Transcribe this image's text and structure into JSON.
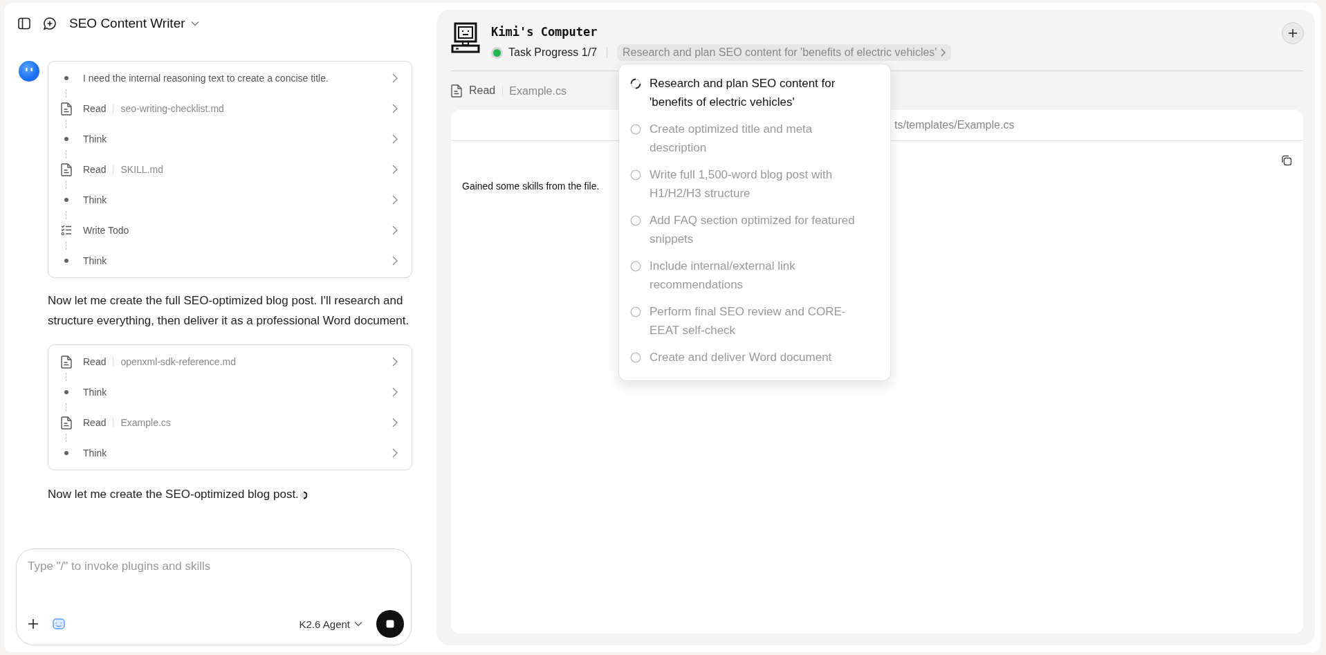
{
  "chat": {
    "title": "SEO Content Writer",
    "step_groups": [
      {
        "steps": [
          {
            "kind": "think",
            "label": "I need the internal reasoning text to create a concise title."
          },
          {
            "kind": "read",
            "label": "Read",
            "file": "seo-writing-checklist.md"
          },
          {
            "kind": "think",
            "label": "Think"
          },
          {
            "kind": "read",
            "label": "Read",
            "file": "SKILL.md"
          },
          {
            "kind": "think",
            "label": "Think"
          },
          {
            "kind": "todo",
            "label": "Write Todo"
          },
          {
            "kind": "think",
            "label": "Think"
          }
        ],
        "after": "Now let me create the full SEO-optimized blog post. I'll research and structure everything, then deliver it as a professional Word document."
      },
      {
        "steps": [
          {
            "kind": "read",
            "label": "Read",
            "file": "openxml-sdk-reference.md"
          },
          {
            "kind": "think",
            "label": "Think"
          },
          {
            "kind": "read",
            "label": "Read",
            "file": "Example.cs"
          },
          {
            "kind": "think",
            "label": "Think"
          }
        ],
        "after": "Now let me create the SEO-optimized blog post."
      }
    ],
    "composer": {
      "placeholder": "Type \"/\" to invoke plugins and skills",
      "model": "K2.6 Agent"
    }
  },
  "computer": {
    "title": "Kimi's Computer",
    "running": true,
    "progress": "Task Progress 1/7",
    "current_task": "Research and plan SEO content for 'benefits of electric vehicles'",
    "action": {
      "label": "Read",
      "file": "Example.cs"
    },
    "file_path": "ts/templates/Example.cs",
    "content": "Gained some skills from the file.",
    "tasks": [
      {
        "label": "Research and plan SEO content for 'benefits of electric vehicles'",
        "active": true
      },
      {
        "label": "Create optimized title and meta description",
        "active": false
      },
      {
        "label": "Write full 1,500-word blog post with H1/H2/H3 structure",
        "active": false
      },
      {
        "label": "Add FAQ section optimized for featured snippets",
        "active": false
      },
      {
        "label": "Include internal/external link recommendations",
        "active": false
      },
      {
        "label": "Perform final SEO review and CORE-EEAT self-check",
        "active": false
      },
      {
        "label": "Create and deliver Word document",
        "active": false
      }
    ]
  }
}
